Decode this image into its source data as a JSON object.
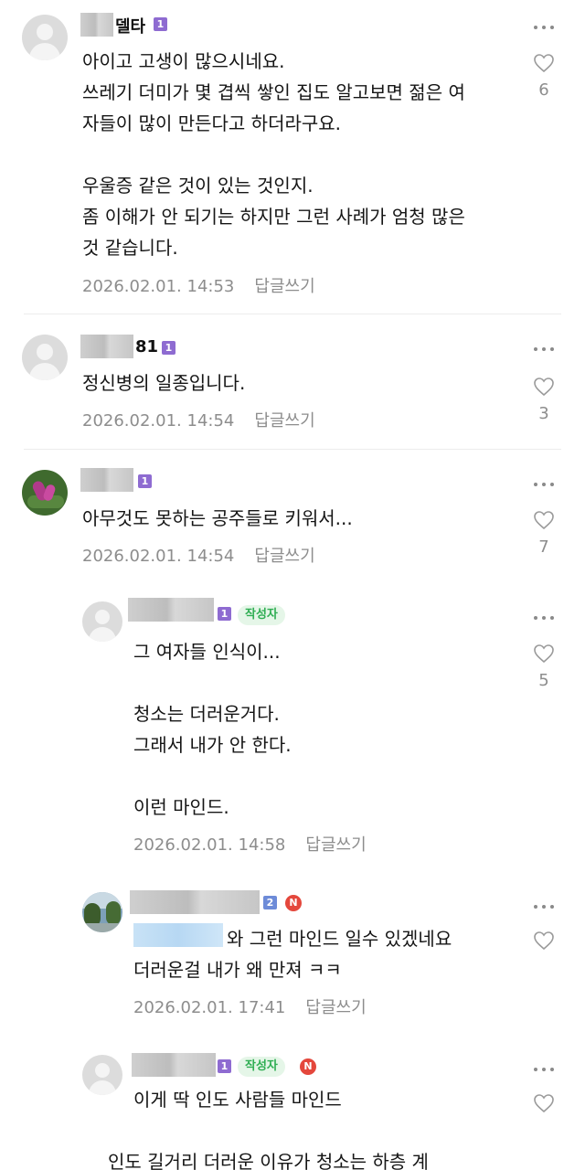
{
  "comments": [
    {
      "nickname_visible": "델타",
      "level": "1",
      "text": "아이고 고생이 많으시네요.\n쓰레기 더미가 몇 겹씩 쌓인 집도 알고보면 젊은 여자들이 많이 만든다고 하더라구요.\n\n우울증 같은 것이 있는 것인지.\n좀 이해가 안 되기는 하지만 그런 사례가 엄청 많은 것 같습니다.",
      "text_lines": [
        "아이고 고생이 많으시네요.",
        "쓰레기 더미가 몇 겹씩 쌓인 집도 알고보면 젊은 여",
        "자들이 많이 만든다고 하더라구요.",
        "",
        "우울증 같은 것이 있는 것인지.",
        "좀 이해가 안 되기는 하지만 그런 사례가 엄청 많은",
        "것 같습니다."
      ],
      "timestamp": "2026.02.01. 14:53",
      "reply_label": "답글쓰기",
      "likes": "6"
    },
    {
      "nickname_visible": "81",
      "level": "1",
      "text_lines": [
        "정신병의 일종입니다."
      ],
      "timestamp": "2026.02.01. 14:54",
      "reply_label": "답글쓰기",
      "likes": "3"
    },
    {
      "nickname_visible": "",
      "level": "1",
      "text_lines": [
        "아무것도 못하는 공주들로 키워서..."
      ],
      "timestamp": "2026.02.01. 14:54",
      "reply_label": "답글쓰기",
      "likes": "7"
    },
    {
      "nickname_visible": "",
      "level": "1",
      "author_badge": "작성자",
      "text_lines": [
        "그 여자들 인식이...",
        "",
        "청소는 더러운거다.",
        "그래서 내가 안 한다.",
        "",
        "이런 마인드."
      ],
      "timestamp": "2026.02.01. 14:58",
      "reply_label": "답글쓰기",
      "likes": "5"
    },
    {
      "nickname_visible": "",
      "level": "2",
      "new_badge": "N",
      "text_lines": [
        "와 그런 마인드 일수 있겠네요",
        "더러운걸 내가 왜 만져 ㅋㅋ"
      ],
      "timestamp": "2026.02.01. 17:41",
      "reply_label": "답글쓰기",
      "likes": ""
    },
    {
      "nickname_visible": "",
      "level": "1",
      "author_badge": "작성자",
      "new_badge": "N",
      "text_lines": [
        "이게 딱 인도 사람들 마인드",
        "",
        "인도 길거리 더러운 이유가 청소는 하층 계"
      ],
      "timestamp": "",
      "reply_label": "",
      "likes": ""
    }
  ],
  "icons": {
    "more": "more-dots-icon",
    "like": "heart-icon",
    "avatar": "default-avatar-icon"
  },
  "colors": {
    "level_badge": "#8e6bd1",
    "author_badge_bg": "#e5f6e8",
    "author_badge_text": "#2fae53",
    "new_badge": "#e4473c",
    "meta_text": "#8d8d8d"
  }
}
